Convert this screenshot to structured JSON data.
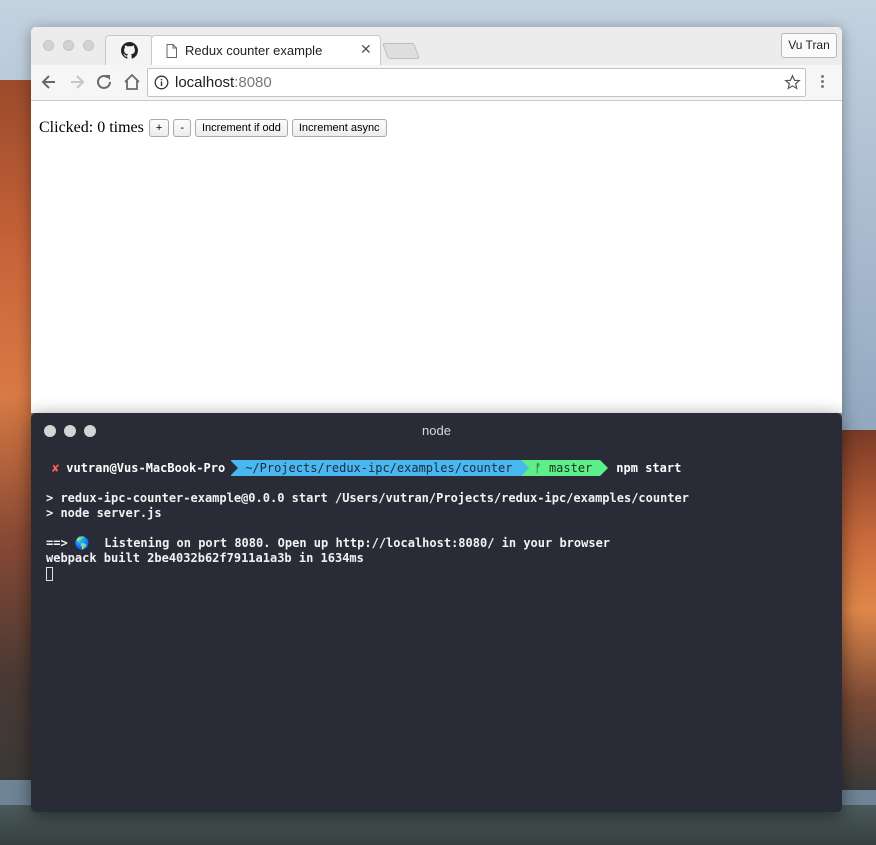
{
  "browser": {
    "tabs": [
      {
        "icon": "github-icon",
        "label": ""
      },
      {
        "icon": "document-icon",
        "label": "Redux counter example"
      }
    ],
    "profile_label": "Vu Tran",
    "url_host": "localhost",
    "url_port": ":8080"
  },
  "page": {
    "clicked_text": "Clicked: 0 times",
    "buttons": {
      "increment": "+",
      "decrement": "-",
      "increment_if_odd": "Increment if odd",
      "increment_async": "Increment async"
    }
  },
  "terminal": {
    "title": "node",
    "prompt": {
      "status_mark": "✘",
      "user_host": "vutran@Vus-MacBook-Pro",
      "path": "~/Projects/redux-ipc/examples/counter",
      "branch_glyph": "ᚠ",
      "branch": "master",
      "command": "npm start"
    },
    "output": [
      "> redux-ipc-counter-example@0.0.0 start /Users/vutran/Projects/redux-ipc/examples/counter",
      "> node server.js"
    ],
    "output2": [
      "==> 🌎  Listening on port 8080. Open up http://localhost:8080/ in your browser",
      "webpack built 2be4032b62f7911a1a3b in 1634ms"
    ]
  },
  "colors": {
    "terminal_bg": "#292c36",
    "path_segment": "#4ab8f0",
    "git_segment": "#5df08a",
    "error_mark": "#ff5f56"
  }
}
